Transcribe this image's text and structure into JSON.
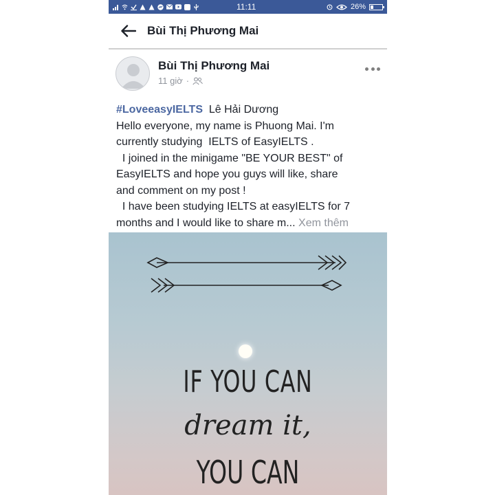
{
  "status_bar": {
    "time": "11:11",
    "battery": "26%",
    "battery_level": 0.26
  },
  "header": {
    "title": "Bùi Thị Phương Mai"
  },
  "post": {
    "author": "Bùi Thị Phương Mai",
    "time": "11 giờ",
    "separator": "·",
    "hashtag": "#LoveeasyIELTS",
    "tagged": "Lê Hải Dương",
    "lines": [
      "Hello everyone, my name is Phuong Mai. I'm",
      "currently studying  IELTS of EasyIELTS .",
      "  I joined in the minigame \"BE YOUR BEST\" of",
      "EasyIELTS and hope you guys will like, share",
      "and comment on my post !",
      "  I have been studying IELTS at easyIELTS for 7"
    ],
    "last_line": "months and I would like to share m...",
    "see_more": "Xem thêm"
  },
  "image": {
    "line1": "IF YOU CAN",
    "line2": "dream it,",
    "line3": "YOU CAN"
  }
}
